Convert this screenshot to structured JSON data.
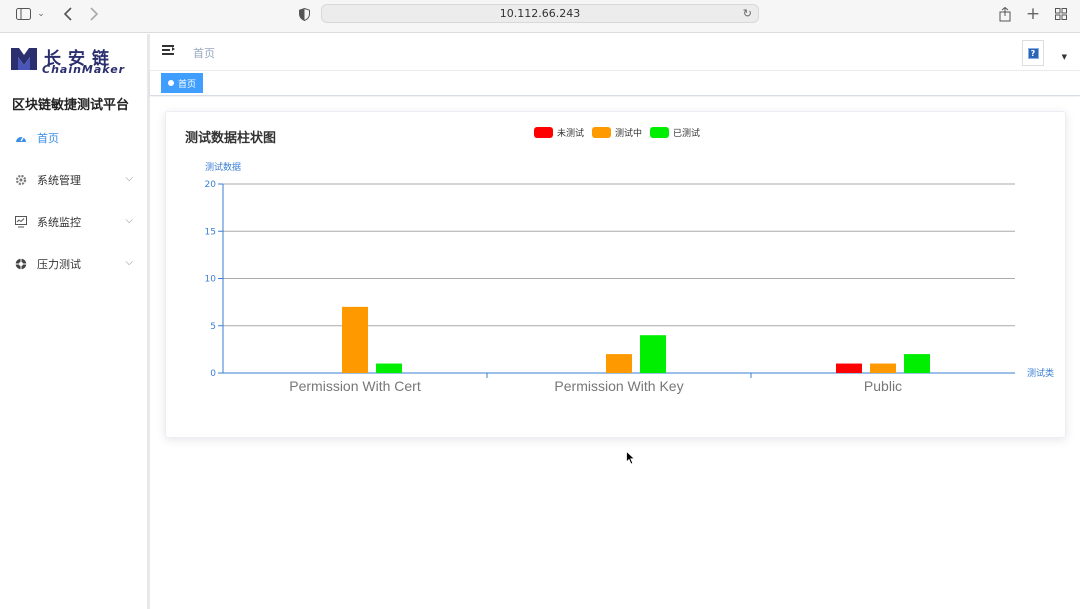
{
  "browser": {
    "url": "10.112.66.243"
  },
  "sidebar": {
    "logo_cn": "长安链",
    "logo_en": "ChainMaker",
    "platform_title": "区块链敏捷测试平台",
    "items": [
      {
        "label": "首页",
        "icon": "dashboard-icon",
        "active": true
      },
      {
        "label": "系统管理",
        "icon": "gear-icon"
      },
      {
        "label": "系统监控",
        "icon": "monitor-icon"
      },
      {
        "label": "压力测试",
        "icon": "aperture-icon"
      }
    ]
  },
  "header": {
    "breadcrumb": "首页",
    "help_label": "?"
  },
  "tags": {
    "active_tag": "首页"
  },
  "card": {
    "title": "测试数据柱状图"
  },
  "colors": {
    "untested": "#ff0000",
    "testing": "#ff9900",
    "tested": "#00ee00",
    "accent": "#409eff",
    "axis": "#3a7fd5"
  },
  "chart_data": {
    "type": "bar",
    "title": "测试数据柱状图",
    "ylabel": "测试数据",
    "xlabel": "测试类",
    "categories": [
      "Permission With Cert",
      "Permission With Key",
      "Public"
    ],
    "series": [
      {
        "name": "未测试",
        "values": [
          0,
          0,
          1
        ]
      },
      {
        "name": "测试中",
        "values": [
          7,
          2,
          1
        ]
      },
      {
        "name": "已测试",
        "values": [
          1,
          4,
          2
        ]
      }
    ],
    "ylim": [
      0,
      20
    ],
    "yticks": [
      0,
      5,
      10,
      15,
      20
    ],
    "grid": true,
    "legend": "top-center"
  }
}
